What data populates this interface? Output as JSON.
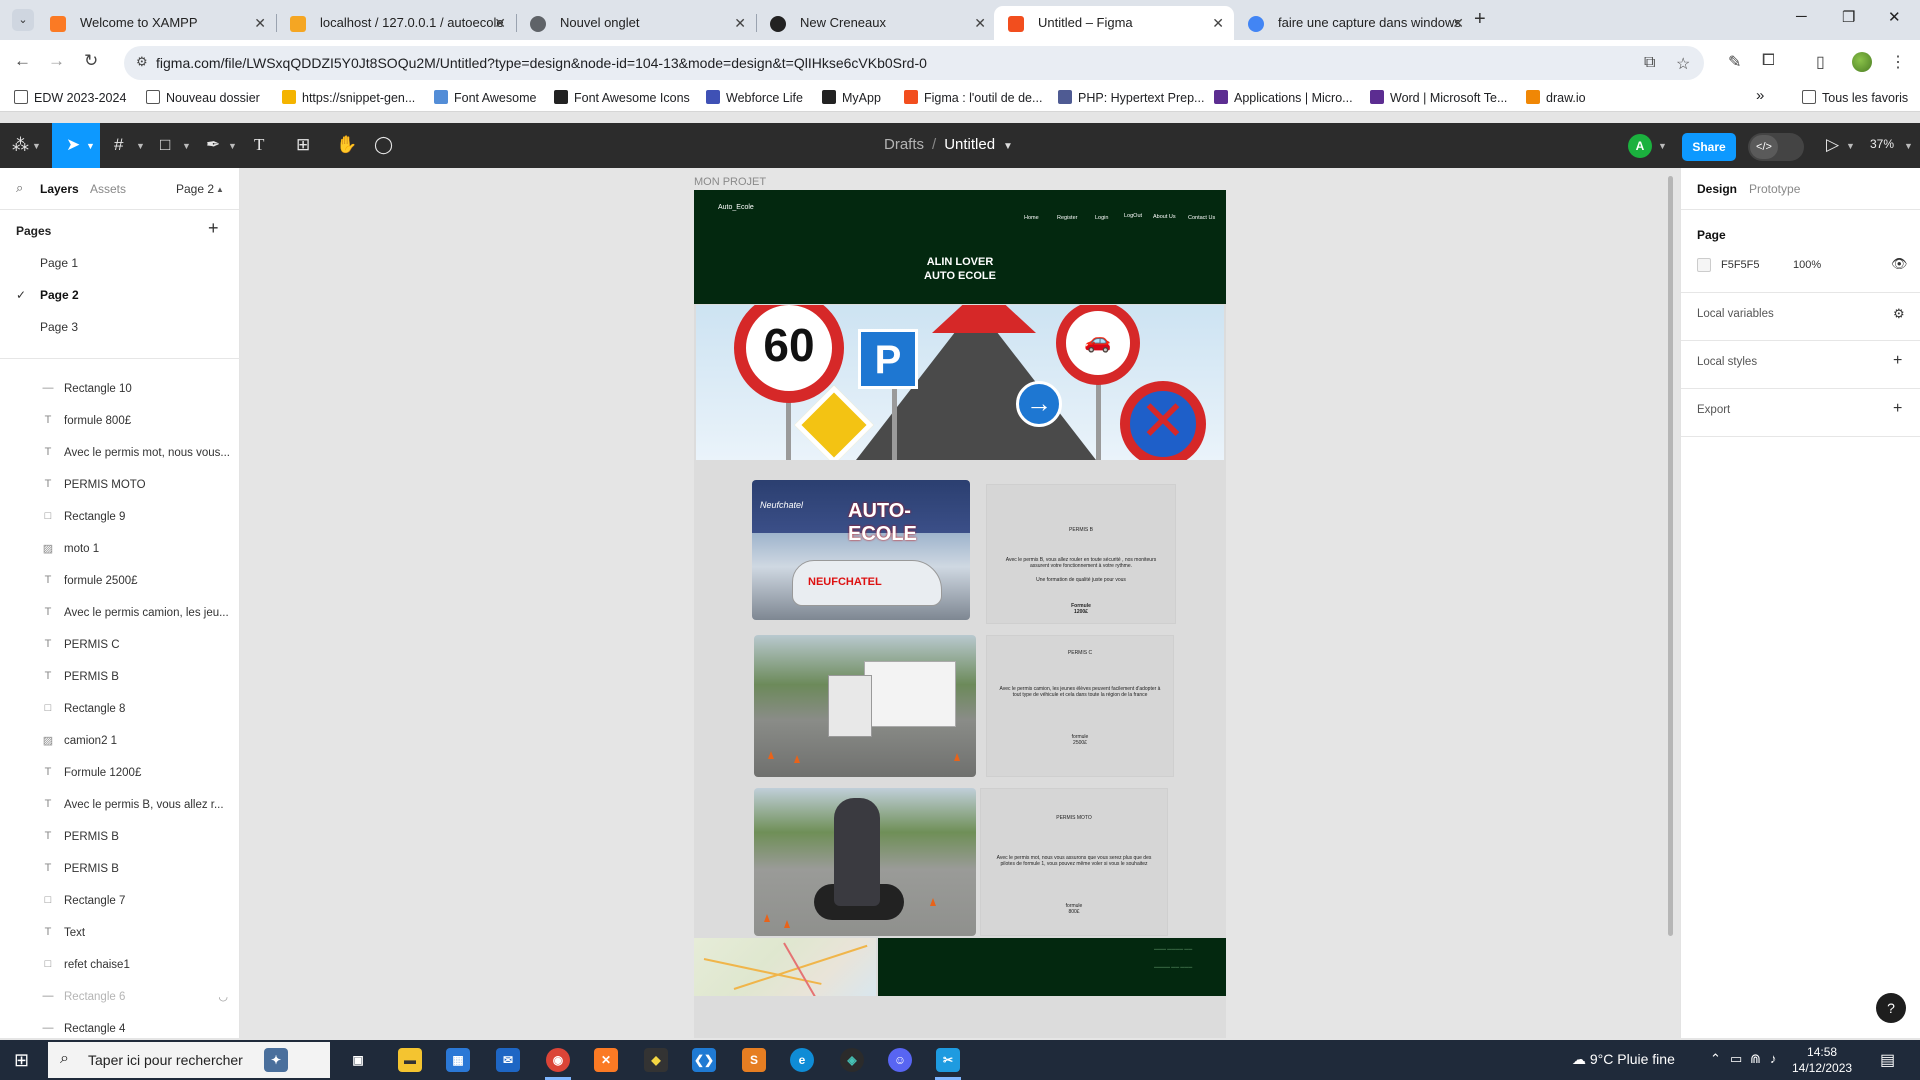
{
  "browser": {
    "launcher_icon": "chrome-tab-search-icon",
    "tabs": [
      {
        "title": "Welcome to XAMPP",
        "icon": "xampp-icon",
        "color": "#fb7a24",
        "active": false
      },
      {
        "title": "localhost / 127.0.0.1 / autoecole",
        "icon": "phpmyadmin-icon",
        "color": "#f5a623",
        "active": false
      },
      {
        "title": "Nouvel onglet",
        "icon": "chrome-icon",
        "color": "#5f6368",
        "active": false
      },
      {
        "title": "New Creneaux",
        "icon": "github-icon",
        "color": "#222222",
        "active": false
      },
      {
        "title": "Untitled – Figma",
        "icon": "figma-icon",
        "color": "#f24e1e",
        "active": true
      },
      {
        "title": "faire une capture dans windows",
        "icon": "google-icon",
        "color": "#4285f4",
        "active": false
      }
    ],
    "new_tab": "+",
    "url": "figma.com/file/LWSxqQDDZI5Y0Jt8SOQu2M/Untitled?type=design&node-id=104-13&mode=design&t=QlIHkse6cVKb0Srd-0",
    "bookmarks": [
      {
        "label": "EDW 2023-2024",
        "color": "#555555"
      },
      {
        "label": "Nouveau dossier",
        "color": "#555555"
      },
      {
        "label": "https://snippet-gen...",
        "color": "#f4b400"
      },
      {
        "label": "Font Awesome",
        "color": "#538dd7"
      },
      {
        "label": "Font Awesome Icons",
        "color": "#222222"
      },
      {
        "label": "Webforce Life",
        "color": "#3f51b5"
      },
      {
        "label": "MyApp",
        "color": "#222222"
      },
      {
        "label": "Figma : l'outil de de...",
        "color": "#f24e1e"
      },
      {
        "label": "PHP: Hypertext Prep...",
        "color": "#4f5b93"
      },
      {
        "label": "Applications | Micro...",
        "color": "#5c2d91"
      },
      {
        "label": "Word | Microsoft Te...",
        "color": "#5c2d91"
      },
      {
        "label": "draw.io",
        "color": "#f08705"
      }
    ],
    "bookmarks_more": "»",
    "all_bookmarks": "Tous les favoris"
  },
  "figma": {
    "breadcrumb_parent": "Drafts",
    "breadcrumb_sep": "/",
    "file_name": "Untitled",
    "avatar_initial": "A",
    "share_label": "Share",
    "zoom": "37%",
    "left_tabs": {
      "layers": "Layers",
      "assets": "Assets",
      "page_switch": "Page 2"
    },
    "pages_heading": "Pages",
    "pages": [
      {
        "name": "Page 1",
        "active": false
      },
      {
        "name": "Page 2",
        "active": true
      },
      {
        "name": "Page 3",
        "active": false
      }
    ],
    "layers": [
      {
        "name": "Rectangle 10",
        "type": "line",
        "hidden": false
      },
      {
        "name": "formule 800£",
        "type": "text",
        "hidden": false
      },
      {
        "name": "Avec le permis mot, nous vous...",
        "type": "text",
        "hidden": false
      },
      {
        "name": "PERMIS MOTO",
        "type": "text",
        "hidden": false
      },
      {
        "name": "Rectangle 9",
        "type": "rect",
        "hidden": false
      },
      {
        "name": "moto 1",
        "type": "image",
        "hidden": false
      },
      {
        "name": "formule 2500£",
        "type": "text",
        "hidden": false
      },
      {
        "name": "Avec le permis camion, les jeu...",
        "type": "text",
        "hidden": false
      },
      {
        "name": "PERMIS C",
        "type": "text",
        "hidden": false
      },
      {
        "name": "PERMIS B",
        "type": "text",
        "hidden": false
      },
      {
        "name": "Rectangle 8",
        "type": "rect",
        "hidden": false
      },
      {
        "name": "camion2 1",
        "type": "image",
        "hidden": false
      },
      {
        "name": "Formule 1200£",
        "type": "text",
        "hidden": false
      },
      {
        "name": "Avec le permis B, vous allez r...",
        "type": "text",
        "hidden": false
      },
      {
        "name": "PERMIS B",
        "type": "text",
        "hidden": false
      },
      {
        "name": "PERMIS B",
        "type": "text",
        "hidden": false
      },
      {
        "name": "Rectangle 7",
        "type": "rect",
        "hidden": false
      },
      {
        "name": "Text",
        "type": "text",
        "hidden": false
      },
      {
        "name": "refet chaise1",
        "type": "rect",
        "hidden": false
      },
      {
        "name": "Rectangle 6",
        "type": "line",
        "hidden": true
      },
      {
        "name": "Rectangle 4",
        "type": "line",
        "hidden": false
      }
    ],
    "right_tabs": {
      "design": "Design",
      "prototype": "Prototype"
    },
    "page_section": "Page",
    "page_fill_hex": "F5F5F5",
    "page_fill_color": "#f5f5f5",
    "page_fill_opacity": "100%",
    "local_variables": "Local variables",
    "local_styles": "Local styles",
    "export": "Export",
    "help": "?"
  },
  "canvas": {
    "frame_name": "MON PROJET",
    "site": {
      "logo": "Auto_Ecole",
      "nav": [
        "Home",
        "Register",
        "Login",
        "LogOut",
        "About Us",
        "Contact Us"
      ],
      "title_line1": "ALIN LOVER",
      "title_line2": "AUTO ECOLE",
      "sign_speed": "60",
      "sign_parking": "P",
      "storefront_text": "AUTO-ECOLE",
      "storefront_brand": "Neufchatel",
      "car_text": "NEUFCHATEL",
      "cards": [
        {
          "title": "PERMIS B",
          "body": "Avec le permis B, vous allez rouler en toute sécurité , nos moniteurs assurent votre fonctionnement à votre rythme.",
          "sub": "Une formation de qualité juste pour vous",
          "price_l1": "Formule",
          "price_l2": "1200£"
        },
        {
          "title": "PERMIS C",
          "body": "Avec le permis camion, les jeunes élèves peuvent facilement d'adopter à tout type de véhicule et cela dans toute la région de la france",
          "sub": "",
          "price_l1": "formule",
          "price_l2": "2500£"
        },
        {
          "title": "PERMIS MOTO",
          "body": "Avec le permis mot, nous vous assurons que vous serez plus que des pilotes de formule 1, vous pouvez même voler si vous le souhaitez",
          "sub": "",
          "price_l1": "formule",
          "price_l2": "800£"
        }
      ]
    }
  },
  "taskbar": {
    "search_placeholder": "Taper ici pour rechercher",
    "weather": "9°C  Pluie fine",
    "time": "14:58",
    "date": "14/12/2023"
  }
}
